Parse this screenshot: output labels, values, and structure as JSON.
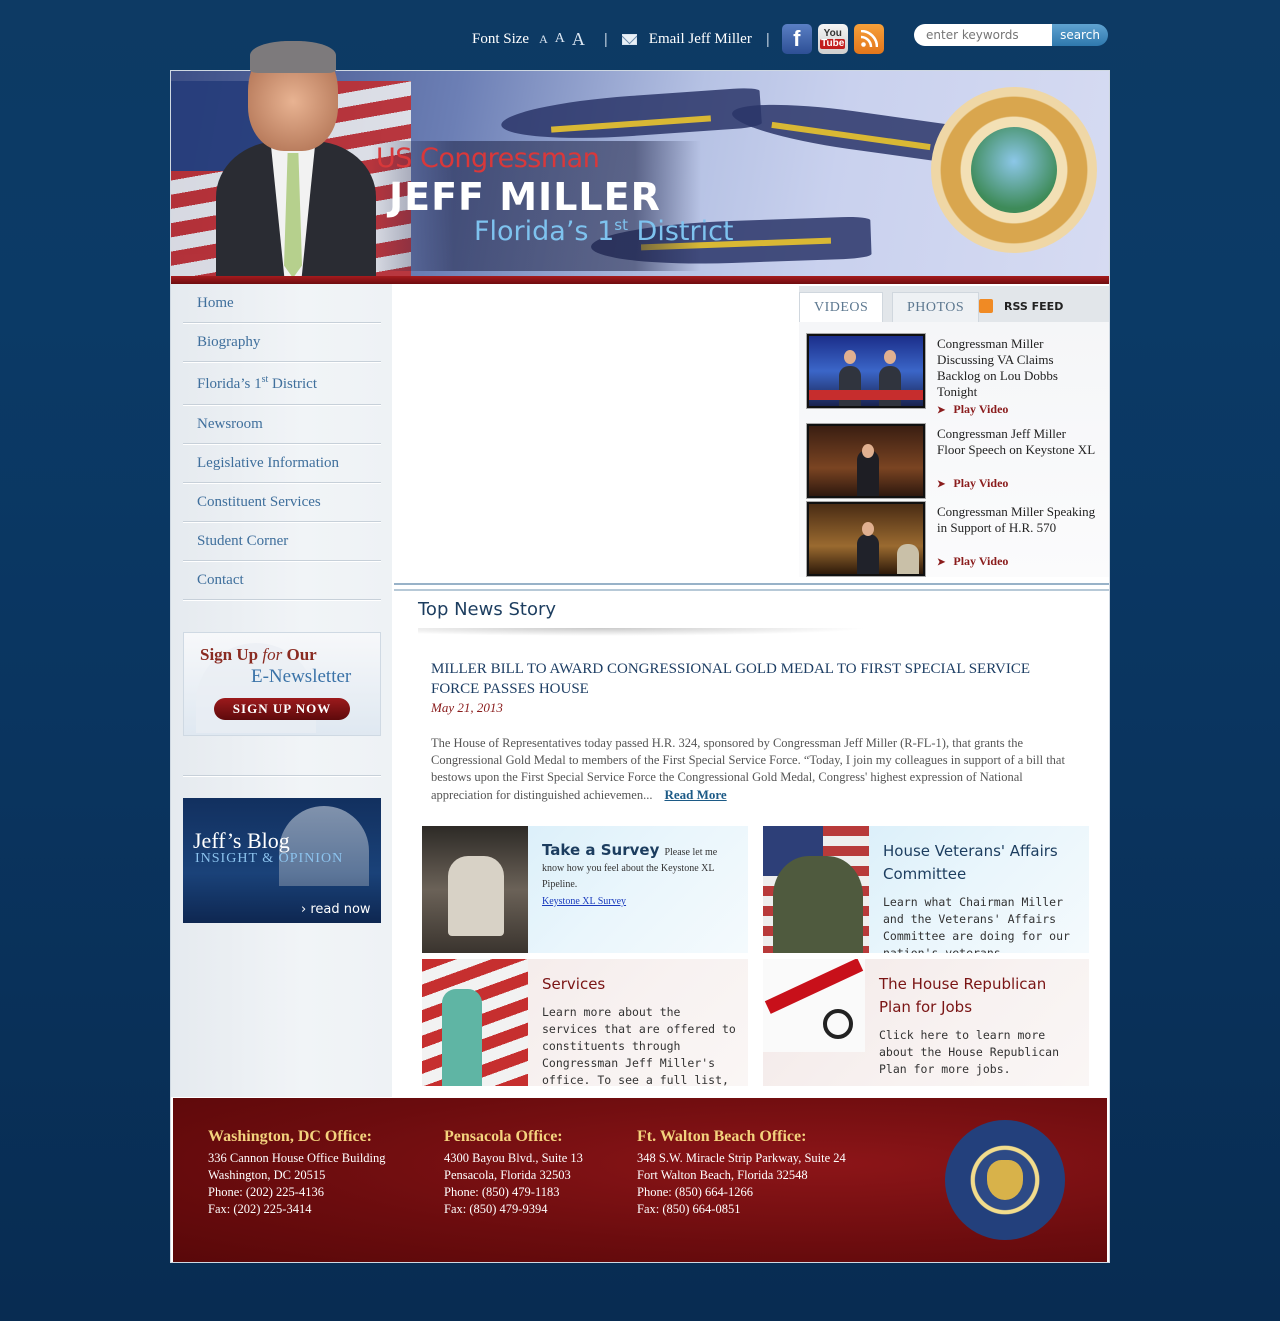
{
  "topbar": {
    "font_size_label": "Font Size",
    "font_sizes": [
      "A",
      "A",
      "A"
    ],
    "email_label": "Email Jeff Miller",
    "search_placeholder": "enter keywords",
    "search_button": "search",
    "facebook_glyph": "f",
    "youtube_you": "You",
    "youtube_tube": "Tube"
  },
  "banner": {
    "line1": "US Congressman",
    "line2": "JEFF MILLER",
    "line3_pre": "Florida’s 1",
    "line3_sup": "st",
    "line3_post": " District"
  },
  "nav": {
    "items": [
      {
        "label": "Home"
      },
      {
        "label": "Biography"
      },
      {
        "label": "Florida’s 1",
        "sup": "st",
        "post": " District"
      },
      {
        "label": "Newsroom"
      },
      {
        "label": "Legislative Information"
      },
      {
        "label": "Constituent Services"
      },
      {
        "label": "Student Corner"
      },
      {
        "label": "Contact"
      }
    ]
  },
  "newsletter": {
    "line1_a": "Sign Up ",
    "line1_b": "for",
    "line1_c": " Our",
    "line2": "E-Newsletter",
    "button": "SIGN UP NOW"
  },
  "blog": {
    "title": "Jeff’s Blog",
    "subtitle": "INSIGHT & OPINION",
    "cta": "› read now"
  },
  "media": {
    "tabs": [
      "VIDEOS",
      "PHOTOS"
    ],
    "rss": "RSS FEED",
    "play_label": "Play Video",
    "videos": [
      {
        "title": "Congressman Miller Discussing VA Claims Backlog on Lou Dobbs Tonight"
      },
      {
        "title": "Congressman Jeff Miller Floor Speech on Keystone XL"
      },
      {
        "title": "Congressman Miller Speaking in Support of H.R. 570"
      }
    ]
  },
  "news": {
    "section_title": "Top News Story",
    "headline": "MILLER BILL TO AWARD CONGRESSIONAL GOLD MEDAL TO FIRST SPECIAL SERVICE FORCE PASSES HOUSE",
    "date": "May 21, 2013",
    "body": "The House of Representatives today passed H.R. 324, sponsored by Congressman Jeff Miller (R-FL-1), that grants the Congressional Gold Medal to members of the First Special Service Force. “Today, I join my colleagues in support of a bill that bestows upon the First Special Service Force the Congressional Gold Medal, Congress' highest expression of National appreciation for distinguished achievemen...",
    "read_more": "Read More"
  },
  "features": {
    "survey": {
      "title": "Take a Survey",
      "text": "Please let me know how you feel about the Keystone XL Pipeline.",
      "link": "Keystone XL Survey"
    },
    "veterans": {
      "title": "House Veterans' Affairs Committee",
      "text": "Learn what Chairman Miller and the Veterans' Affairs Committee are doing for our nation's veterans."
    },
    "services": {
      "title": "Services",
      "text": "Learn more about the services that are offered to constituents through Congressman Jeff Miller's office. To see a full list, click here."
    },
    "jobs": {
      "title": "The House Republican Plan for Jobs",
      "text": "Click here to learn more about the House Republican Plan for more jobs."
    }
  },
  "footer": {
    "offices": [
      {
        "title": "Washington, DC Office:",
        "lines": [
          "336 Cannon House Office Building",
          "Washington, DC 20515",
          "Phone: (202) 225-4136",
          "Fax: (202) 225-3414"
        ]
      },
      {
        "title": "Pensacola Office:",
        "lines": [
          "4300 Bayou Blvd., Suite 13",
          "Pensacola, Florida 32503",
          "Phone: (850) 479-1183",
          "Fax: (850) 479-9394"
        ]
      },
      {
        "title": "Ft. Walton Beach Office:",
        "lines": [
          "348 S.W. Miracle Strip Parkway, Suite 24",
          "Fort Walton Beach, Florida 32548",
          "Phone: (850) 664-1266",
          "Fax: (850) 664-0851"
        ]
      }
    ]
  },
  "colors": {
    "page_bg": "#0b3a66",
    "nav_text": "#3f6f9c",
    "accent_red": "#8a1c1c",
    "footer_red": "#6b0c0e",
    "footer_heading": "#f3d27d"
  },
  "icons": [
    "email-icon",
    "facebook-icon",
    "youtube-icon",
    "rss-icon",
    "play-arrow-icon",
    "florida-seal",
    "house-seal"
  ]
}
